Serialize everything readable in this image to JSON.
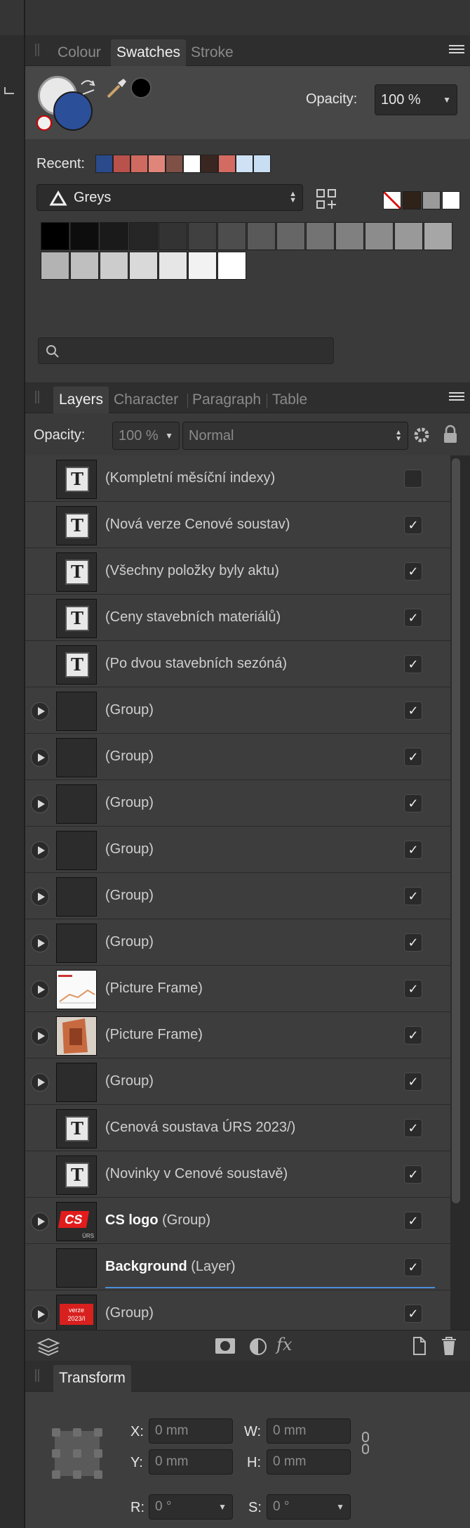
{
  "swatches_tabs": [
    "Colour",
    "Swatches",
    "Stroke"
  ],
  "swatches": {
    "opacity_label": "Opacity:",
    "opacity_value": "100 %",
    "recent_label": "Recent:",
    "recent_colors": [
      "#2b4a8c",
      "#b9524a",
      "#cf6a60",
      "#e0857a",
      "#7e5046",
      "#ffffff",
      "#3a2620",
      "#d36b62",
      "#cfe1f4",
      "#c8dff3"
    ],
    "palette_name": "Greys",
    "palette_colors": [
      "#000000",
      "#0d0d0d",
      "#1a1a1a",
      "#262626",
      "#333333",
      "#404040",
      "#4d4d4d",
      "#595959",
      "#666666",
      "#737373",
      "#808080",
      "#8c8c8c",
      "#999999",
      "#a6a6a6",
      "#b3b3b3",
      "#bfbfbf",
      "#cccccc",
      "#d9d9d9",
      "#e6e6e6",
      "#f2f2f2",
      "#ffffff"
    ],
    "mini_colors": [
      "none",
      "#2e2219",
      "#9a9a9a",
      "#ffffff"
    ]
  },
  "layers_tabs": [
    "Layers",
    "Character",
    "Paragraph",
    "Table"
  ],
  "layers": {
    "opacity_label": "Opacity:",
    "opacity_value": "100 %",
    "blend_mode": "Normal",
    "items": [
      {
        "name": "(Kompletní měsíční indexy)",
        "kind": "text",
        "expand": false,
        "checked": false
      },
      {
        "name": "(Nová verze Cenové soustav)",
        "kind": "text",
        "expand": false,
        "checked": true
      },
      {
        "name": "(Všechny položky byly aktu)",
        "kind": "text",
        "expand": false,
        "checked": true
      },
      {
        "name": "(Ceny stavebních materiálů)",
        "kind": "text",
        "expand": false,
        "checked": true
      },
      {
        "name": "(Po dvou stavebních sezóná)",
        "kind": "text",
        "expand": false,
        "checked": true
      },
      {
        "name": "(Group)",
        "kind": "empty",
        "expand": true,
        "checked": true
      },
      {
        "name": "(Group)",
        "kind": "empty",
        "expand": true,
        "checked": true
      },
      {
        "name": "(Group)",
        "kind": "empty",
        "expand": true,
        "checked": true
      },
      {
        "name": "(Group)",
        "kind": "empty",
        "expand": true,
        "checked": true
      },
      {
        "name": "(Group)",
        "kind": "empty",
        "expand": true,
        "checked": true
      },
      {
        "name": "(Group)",
        "kind": "empty",
        "expand": true,
        "checked": true
      },
      {
        "name": "(Picture Frame)",
        "kind": "chart",
        "expand": true,
        "checked": true
      },
      {
        "name": "(Picture Frame)",
        "kind": "photo",
        "expand": true,
        "checked": true
      },
      {
        "name": "(Group)",
        "kind": "empty",
        "expand": true,
        "checked": true
      },
      {
        "name": "(Cenová soustava ÚRS 2023/)",
        "kind": "text",
        "expand": false,
        "checked": true
      },
      {
        "name": "(Novinky v Cenové soustavě)",
        "kind": "text",
        "expand": false,
        "checked": true
      },
      {
        "name": "(Group)",
        "bold": "CS logo",
        "kind": "logo",
        "expand": true,
        "checked": true
      },
      {
        "name": "(Layer)",
        "bold": "Background",
        "kind": "empty",
        "expand": false,
        "checked": true
      },
      {
        "name": "(Group)",
        "kind": "verze",
        "expand": true,
        "checked": true
      }
    ],
    "logo_text": "CS",
    "logo_sub": "ÚRS",
    "verze_text": "verze",
    "verze_year": "2023/I"
  },
  "footer_fx": "fx",
  "transform": {
    "title": "Transform",
    "x_label": "X:",
    "x_value": "0 mm",
    "y_label": "Y:",
    "y_value": "0 mm",
    "w_label": "W:",
    "w_value": "0 mm",
    "h_label": "H:",
    "h_value": "0 mm",
    "r_label": "R:",
    "r_value": "0 °",
    "s_label": "S:",
    "s_value": "0 °"
  }
}
